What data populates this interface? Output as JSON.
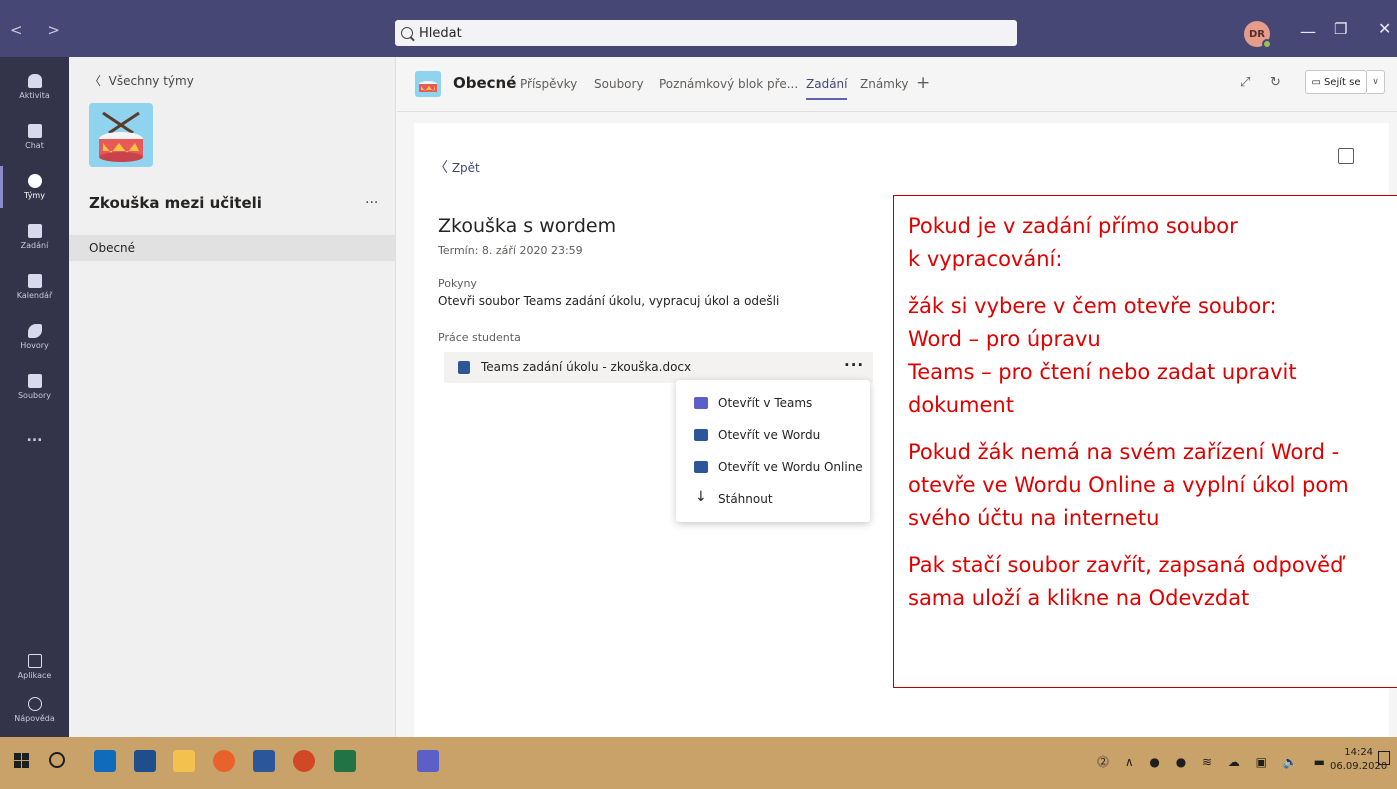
{
  "titlebar": {
    "search_placeholder": "Hledat",
    "user_initials": "DR"
  },
  "rail": {
    "items": [
      {
        "label": "Aktivita",
        "icon": "bell-icon"
      },
      {
        "label": "Chat",
        "icon": "chat-icon"
      },
      {
        "label": "Týmy",
        "icon": "teams-icon",
        "active": true
      },
      {
        "label": "Zadání",
        "icon": "assignments-icon"
      },
      {
        "label": "Kalendář",
        "icon": "calendar-icon"
      },
      {
        "label": "Hovory",
        "icon": "phone-icon"
      },
      {
        "label": "Soubory",
        "icon": "files-icon"
      }
    ],
    "more": "...",
    "apps_label": "Aplikace",
    "help_label": "Nápověda"
  },
  "teampanel": {
    "back_label": "Všechny týmy",
    "team_name": "Zkouška mezi učiteli",
    "more": "...",
    "channel": "Obecné"
  },
  "channel": {
    "title": "Obecné",
    "tabs": [
      "Příspěvky",
      "Soubory",
      "Poznámkový blok pře...",
      "Zadání",
      "Známky"
    ],
    "active_tab": "Zadání",
    "meet_label": "Sejít se"
  },
  "assignment": {
    "back_label": "Zpět",
    "title": "Zkouška s wordem",
    "due": "Termín: 8. září 2020 23:59",
    "instructions_label": "Pokyny",
    "instructions": "Otevři soubor Teams zadání úkolu, vypracuj úkol a odešli",
    "student_work_label": "Práce studenta",
    "file_name": "Teams zadání úkolu - zkouška.docx"
  },
  "menu": {
    "items": [
      {
        "label": "Otevřít v Teams",
        "icon": "teams-icon"
      },
      {
        "label": "Otevřít ve Wordu",
        "icon": "word-icon"
      },
      {
        "label": "Otevřít ve Wordu Online",
        "icon": "word-icon"
      },
      {
        "label": "Stáhnout",
        "icon": "download-icon"
      }
    ]
  },
  "note": {
    "lines": [
      "Pokud je v zadání přímo soubor",
      "k vypracování:",
      "žák si vybere v čem otevře soubor:",
      "Word – pro úpravu",
      "Teams – pro čtení nebo zadat upravit",
      "dokument",
      "Pokud žák nemá na svém zařízení Word -",
      "otevře ve Wordu Online a vyplní úkol pom",
      "svého účtu na internetu",
      "Pak stačí soubor zavřít, zapsaná odpověď",
      "sama uloží a klikne na Odevzdat"
    ]
  },
  "taskbar": {
    "time": "14:24",
    "date": "06.09.2020"
  },
  "colors": {
    "titlebar": "#464775",
    "rail": "#33344a",
    "accent": "#6264a7",
    "note_text": "#e00000",
    "note_border": "#c00000",
    "taskbar": "#c9a26a"
  }
}
